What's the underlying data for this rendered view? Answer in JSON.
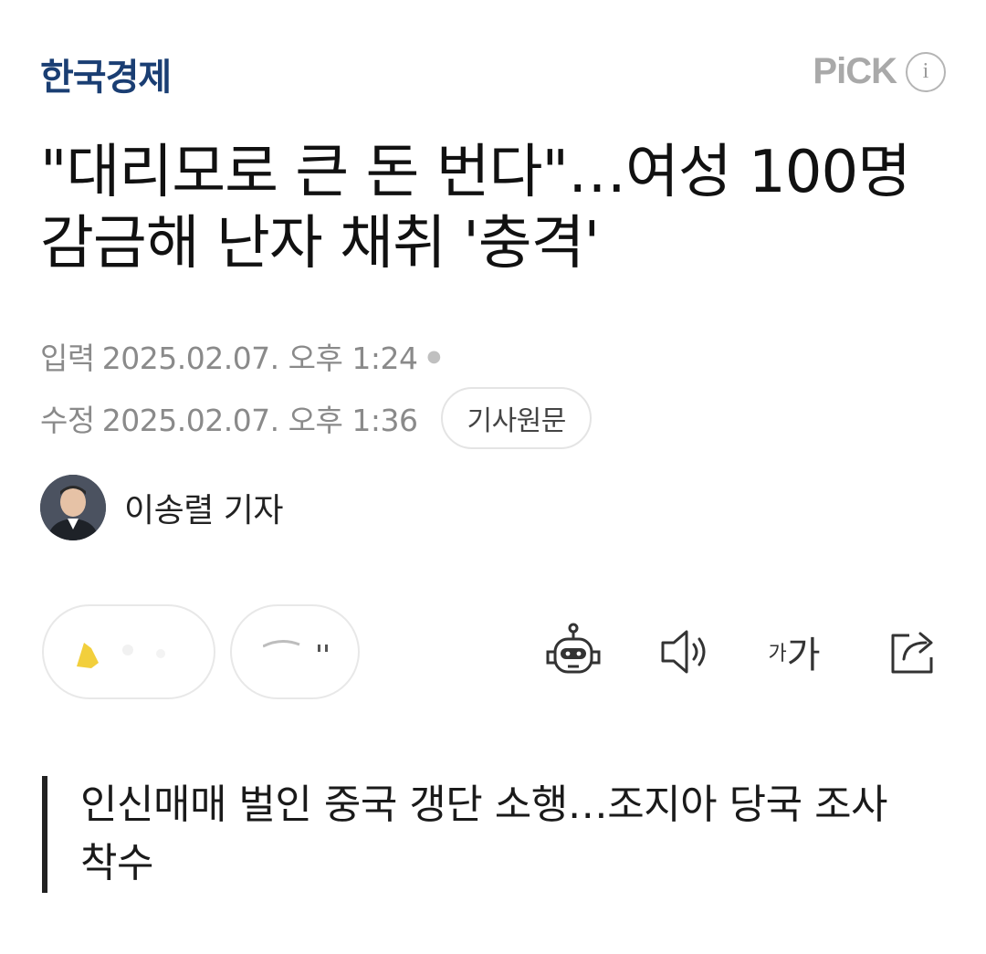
{
  "header": {
    "press_name": "한국경제",
    "pick_label": "PiCK",
    "info_glyph": "i"
  },
  "article": {
    "title": "\"대리모로 큰 돈 번다\"…여성 100명 감금해 난자 채취 '충격'",
    "input_label": "입력",
    "input_date": "2025.02.07. 오후 1:24",
    "modified_label": "수정",
    "modified_date": "2025.02.07. 오후 1:36",
    "original_link_label": "기사원문",
    "reporter_name": "이송렬 기자",
    "summary": "인신매매 벌인 중국 갱단 소행…조지아 당국 조사 착수"
  },
  "toolbar": {
    "font_small_glyph": "가",
    "font_big_glyph": "가",
    "icons": [
      "robot-summary-icon",
      "speaker-icon",
      "font-size-icon",
      "share-icon"
    ]
  },
  "colors": {
    "press_logo": "#1a3e73",
    "pick": "#a9a9a9",
    "meta_text": "#8a8a8a",
    "title": "#111111"
  }
}
